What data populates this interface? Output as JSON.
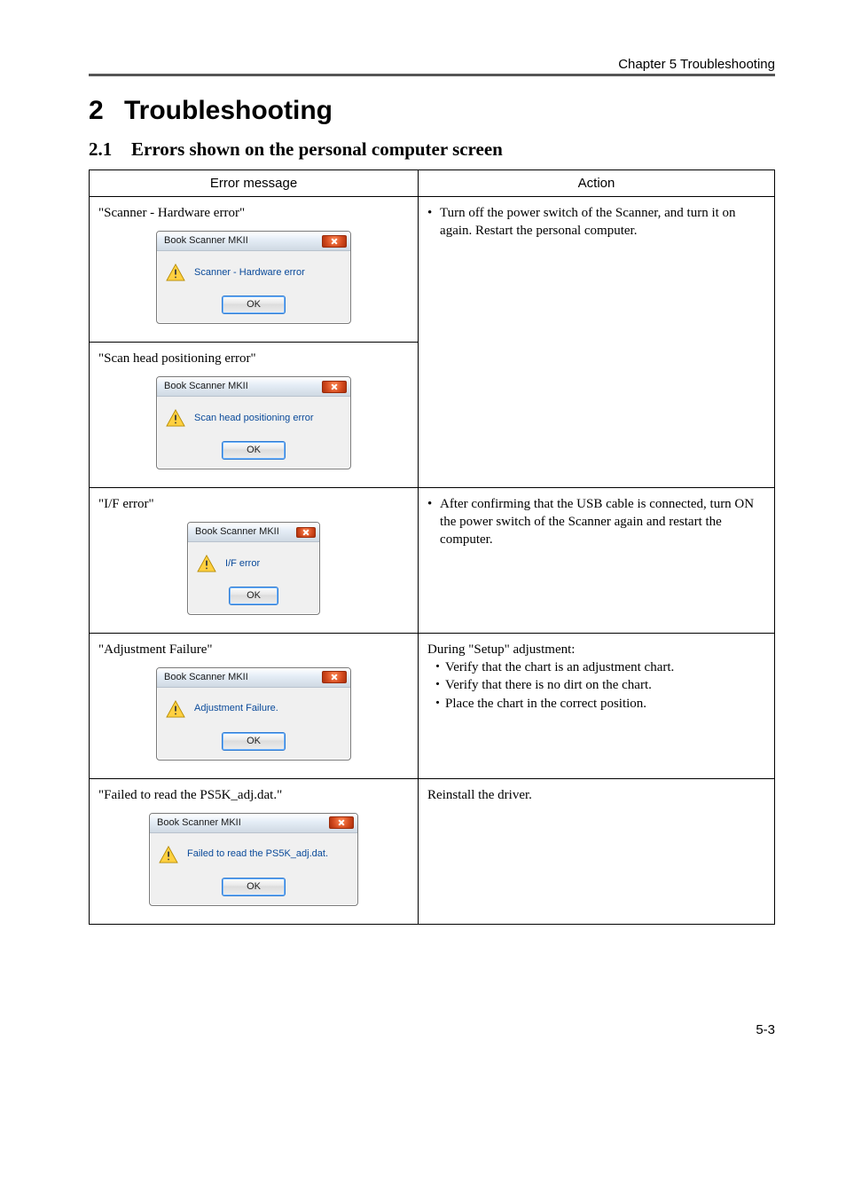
{
  "header": {
    "chapter": "Chapter 5 Troubleshooting"
  },
  "section": {
    "num": "2",
    "title": "Troubleshooting",
    "sub_num": "2.1",
    "sub_title": "Errors shown on the personal computer screen"
  },
  "columns": {
    "error": "Error message",
    "action": "Action"
  },
  "rows": {
    "r1a_label": "\"Scanner - Hardware error\"",
    "r1b_label": "\"Scan head positioning error\"",
    "r1_action": "Turn off the power switch of the Scanner, and turn it on again. Restart the personal computer.",
    "r2_label": "\"I/F error\"",
    "r2_action": "After confirming that the USB cable is connected, turn ON the power switch of the Scanner again and restart the computer.",
    "r3_label": "\"Adjustment Failure\"",
    "r3_intro": "During \"Setup\" adjustment:",
    "r3_b1": "Verify that the chart is an adjustment chart.",
    "r3_b2": "Verify that there is no dirt on the chart.",
    "r3_b3": "Place the chart in the correct position.",
    "r4_label": "\"Failed to read the PS5K_adj.dat.\"",
    "r4_action": "Reinstall the driver."
  },
  "dialogs": {
    "title": "Book Scanner MKII",
    "ok": "OK",
    "msg_hw": "Scanner - Hardware error",
    "msg_pos": "Scan head positioning error",
    "msg_if": "I/F error",
    "msg_adj": "Adjustment Failure.",
    "msg_read": "Failed to read the PS5K_adj.dat."
  },
  "footer": {
    "page": "5-3"
  }
}
